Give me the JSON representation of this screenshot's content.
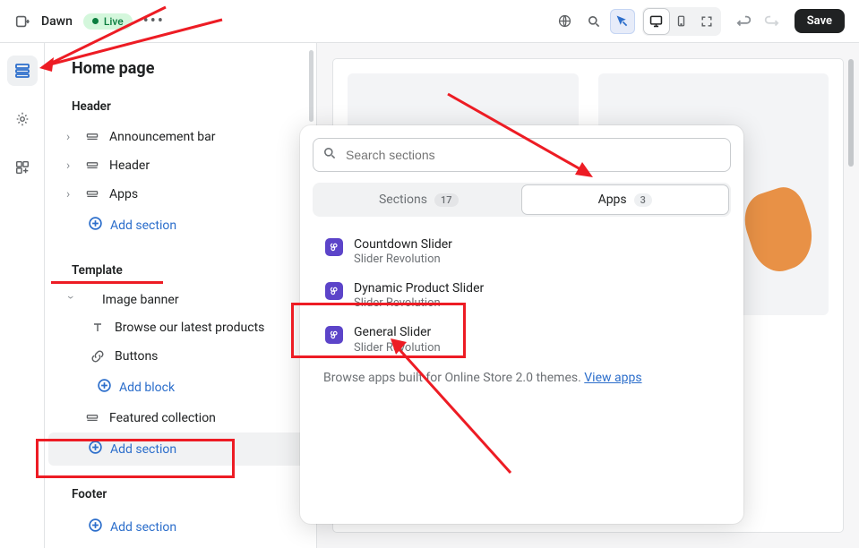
{
  "top": {
    "theme": "Dawn",
    "status": "Live",
    "save": "Save"
  },
  "sidebar": {
    "page_title": "Home page",
    "header_label": "Header",
    "announcement": "Announcement bar",
    "header_item": "Header",
    "apps_item": "Apps",
    "add_section_header": "Add section",
    "template_label": "Template",
    "image_banner": "Image banner",
    "browse_products": "Browse our latest products",
    "buttons": "Buttons",
    "add_block": "Add block",
    "featured_collection": "Featured collection",
    "add_section_template": "Add section",
    "footer_label": "Footer",
    "add_section_footer": "Add section"
  },
  "popover": {
    "search_placeholder": "Search sections",
    "tab_sections": "Sections",
    "count_sections": "17",
    "tab_apps": "Apps",
    "count_apps": "3",
    "apps": [
      {
        "title": "Countdown Slider",
        "sub": "Slider Revolution"
      },
      {
        "title": "Dynamic Product Slider",
        "sub": "Slider Revolution"
      },
      {
        "title": "General Slider",
        "sub": "Slider Revolution"
      }
    ],
    "browse_prefix": "Browse apps built for Online Store 2.0 themes. ",
    "browse_link": "View apps"
  }
}
